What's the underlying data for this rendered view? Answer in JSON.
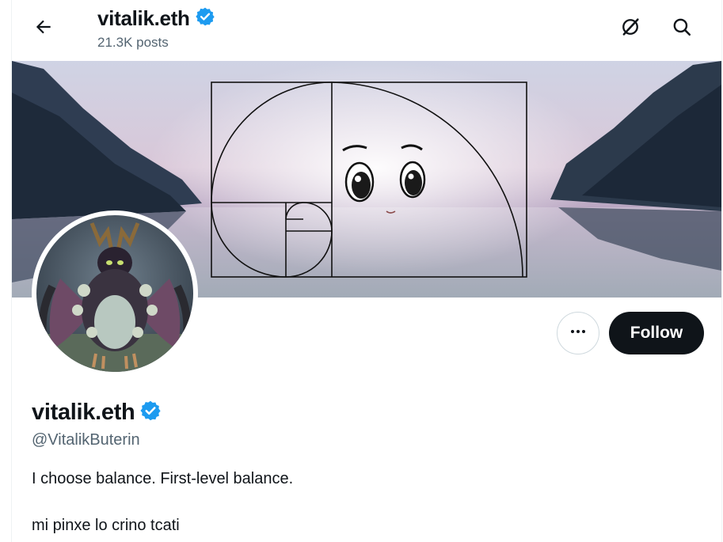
{
  "header": {
    "title": "vitalik.eth",
    "posts_count": "21.3K posts",
    "back_icon": "arrow-left-icon",
    "icons": [
      "grok-icon",
      "search-icon"
    ]
  },
  "profile": {
    "display_name": "vitalik.eth",
    "handle": "@VitalikButerin",
    "verified": true,
    "bio_lines": [
      "I choose balance. First-level balance.",
      "mi pinxe lo crino tcati"
    ]
  },
  "actions": {
    "more_icon": "more-dots-icon",
    "follow_label": "Follow"
  },
  "colors": {
    "verified_badge": "#1d9bf0",
    "follow_bg": "#0f1419",
    "muted_text": "#536471"
  }
}
